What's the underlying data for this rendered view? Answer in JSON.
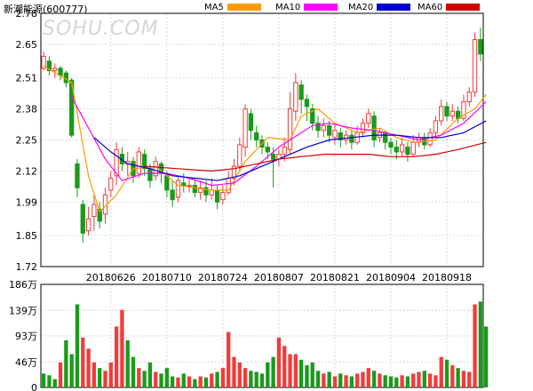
{
  "title": "新潮能源(600777)",
  "watermark": "SOHU.COM",
  "legend": [
    {
      "name": "MA5",
      "color": "#ff9900"
    },
    {
      "name": "MA10",
      "color": "#ff00ff"
    },
    {
      "name": "MA20",
      "color": "#0000cc"
    },
    {
      "name": "MA60",
      "color": "#cc0000"
    }
  ],
  "colors": {
    "up": "#f03c3c",
    "down": "#1a9a1a",
    "grid": "#d8d8d8",
    "frame": "#000000"
  },
  "chart_data": [
    {
      "type": "candlestick",
      "ylim": [
        1.72,
        2.78
      ],
      "yticks": [
        "2.78",
        "2.65",
        "2.51",
        "2.38",
        "2.25",
        "2.12",
        "1.99",
        "1.85",
        "1.72"
      ],
      "xticks": [
        "20180626",
        "20180710",
        "20180724",
        "20180807",
        "20180821",
        "20180904",
        "20180918"
      ],
      "xtick_index": [
        12,
        22,
        32,
        42,
        52,
        62,
        72
      ],
      "candles": [
        [
          2.55,
          2.6,
          2.62,
          2.54
        ],
        [
          2.58,
          2.54,
          2.6,
          2.52
        ],
        [
          2.54,
          2.55,
          2.57,
          2.51
        ],
        [
          2.55,
          2.52,
          2.56,
          2.5
        ],
        [
          2.53,
          2.49,
          2.54,
          2.47
        ],
        [
          2.5,
          2.27,
          2.51,
          2.26
        ],
        [
          2.15,
          2.05,
          2.17,
          2.01
        ],
        [
          1.98,
          1.86,
          2.0,
          1.82
        ],
        [
          1.87,
          1.92,
          1.97,
          1.85
        ],
        [
          1.93,
          1.98,
          2.02,
          1.87
        ],
        [
          1.96,
          1.91,
          1.99,
          1.88
        ],
        [
          1.94,
          2.02,
          2.05,
          1.9
        ],
        [
          2.04,
          2.09,
          2.12,
          2.01
        ],
        [
          2.1,
          2.21,
          2.24,
          2.06
        ],
        [
          2.19,
          2.15,
          2.22,
          2.12
        ],
        [
          2.15,
          2.16,
          2.2,
          2.1
        ],
        [
          2.16,
          2.1,
          2.18,
          2.07
        ],
        [
          2.11,
          2.2,
          2.22,
          2.09
        ],
        [
          2.19,
          2.13,
          2.21,
          2.1
        ],
        [
          2.13,
          2.08,
          2.15,
          2.05
        ],
        [
          2.1,
          2.16,
          2.18,
          2.08
        ],
        [
          2.15,
          2.11,
          2.16,
          2.07
        ],
        [
          2.1,
          2.04,
          2.12,
          2.01
        ],
        [
          2.04,
          2.0,
          2.08,
          1.97
        ],
        [
          2.01,
          2.08,
          2.1,
          1.99
        ],
        [
          2.07,
          2.06,
          2.11,
          2.03
        ],
        [
          2.06,
          2.06,
          2.09,
          2.03
        ],
        [
          2.06,
          2.03,
          2.08,
          2.01
        ],
        [
          2.03,
          2.05,
          2.08,
          2.0
        ],
        [
          2.05,
          2.02,
          2.08,
          1.99
        ],
        [
          2.02,
          2.04,
          2.09,
          2.0
        ],
        [
          2.04,
          1.99,
          2.06,
          1.96
        ],
        [
          2.0,
          2.03,
          2.06,
          1.98
        ],
        [
          2.03,
          2.09,
          2.12,
          2.02
        ],
        [
          2.09,
          2.14,
          2.17,
          2.06
        ],
        [
          2.14,
          2.23,
          2.26,
          2.12
        ],
        [
          2.22,
          2.38,
          2.4,
          2.18
        ],
        [
          2.36,
          2.29,
          2.38,
          2.25
        ],
        [
          2.28,
          2.25,
          2.31,
          2.22
        ],
        [
          2.25,
          2.22,
          2.27,
          2.19
        ],
        [
          2.22,
          2.2,
          2.24,
          2.17
        ],
        [
          2.19,
          2.17,
          2.22,
          2.05
        ],
        [
          2.17,
          2.19,
          2.21,
          2.14
        ],
        [
          2.19,
          2.22,
          2.26,
          2.16
        ],
        [
          2.21,
          2.38,
          2.45,
          2.19
        ],
        [
          2.37,
          2.49,
          2.53,
          2.33
        ],
        [
          2.48,
          2.42,
          2.5,
          2.36
        ],
        [
          2.42,
          2.39,
          2.44,
          2.33
        ],
        [
          2.38,
          2.32,
          2.4,
          2.29
        ],
        [
          2.32,
          2.29,
          2.35,
          2.26
        ],
        [
          2.29,
          2.31,
          2.34,
          2.26
        ],
        [
          2.31,
          2.27,
          2.33,
          2.24
        ],
        [
          2.26,
          2.29,
          2.32,
          2.23
        ],
        [
          2.28,
          2.25,
          2.3,
          2.22
        ],
        [
          2.25,
          2.27,
          2.29,
          2.23
        ],
        [
          2.27,
          2.24,
          2.29,
          2.21
        ],
        [
          2.24,
          2.28,
          2.31,
          2.23
        ],
        [
          2.28,
          2.32,
          2.34,
          2.26
        ],
        [
          2.32,
          2.36,
          2.38,
          2.3
        ],
        [
          2.35,
          2.25,
          2.37,
          2.22
        ],
        [
          2.26,
          2.28,
          2.3,
          2.24
        ],
        [
          2.28,
          2.24,
          2.29,
          2.21
        ],
        [
          2.24,
          2.22,
          2.26,
          2.19
        ],
        [
          2.22,
          2.2,
          2.25,
          2.17
        ],
        [
          2.2,
          2.23,
          2.26,
          2.18
        ],
        [
          2.22,
          2.19,
          2.24,
          2.16
        ],
        [
          2.19,
          2.24,
          2.27,
          2.18
        ],
        [
          2.24,
          2.26,
          2.28,
          2.22
        ],
        [
          2.26,
          2.23,
          2.28,
          2.21
        ],
        [
          2.23,
          2.28,
          2.3,
          2.22
        ],
        [
          2.28,
          2.33,
          2.35,
          2.26
        ],
        [
          2.33,
          2.39,
          2.42,
          2.31
        ],
        [
          2.39,
          2.35,
          2.41,
          2.33
        ],
        [
          2.35,
          2.37,
          2.4,
          2.33
        ],
        [
          2.37,
          2.34,
          2.39,
          2.32
        ],
        [
          2.34,
          2.41,
          2.44,
          2.33
        ],
        [
          2.41,
          2.45,
          2.47,
          2.39
        ],
        [
          2.45,
          2.67,
          2.7,
          2.43
        ],
        [
          2.67,
          2.61,
          2.72,
          2.58
        ]
      ],
      "ma_lines": {
        "MA5": [
          [
            0,
            2.56
          ],
          [
            5,
            2.49
          ],
          [
            8,
            2.1
          ],
          [
            10,
            1.95
          ],
          [
            13,
            2.02
          ],
          [
            16,
            2.13
          ],
          [
            20,
            2.14
          ],
          [
            24,
            2.06
          ],
          [
            30,
            2.04
          ],
          [
            33,
            2.04
          ],
          [
            36,
            2.16
          ],
          [
            40,
            2.26
          ],
          [
            44,
            2.25
          ],
          [
            46,
            2.35
          ],
          [
            49,
            2.38
          ],
          [
            52,
            2.32
          ],
          [
            56,
            2.28
          ],
          [
            60,
            2.3
          ],
          [
            63,
            2.26
          ],
          [
            66,
            2.24
          ],
          [
            70,
            2.25
          ],
          [
            74,
            2.34
          ],
          [
            77,
            2.38
          ],
          [
            79,
            2.44
          ]
        ],
        "MA10": [
          [
            5,
            2.43
          ],
          [
            8,
            2.3
          ],
          [
            11,
            2.17
          ],
          [
            14,
            2.08
          ],
          [
            18,
            2.11
          ],
          [
            22,
            2.11
          ],
          [
            26,
            2.09
          ],
          [
            30,
            2.06
          ],
          [
            34,
            2.07
          ],
          [
            38,
            2.14
          ],
          [
            42,
            2.22
          ],
          [
            46,
            2.28
          ],
          [
            48,
            2.31
          ],
          [
            51,
            2.32
          ],
          [
            55,
            2.3
          ],
          [
            59,
            2.29
          ],
          [
            63,
            2.27
          ],
          [
            67,
            2.25
          ],
          [
            71,
            2.27
          ],
          [
            75,
            2.32
          ],
          [
            79,
            2.41
          ]
        ],
        "MA20": [
          [
            9,
            2.26
          ],
          [
            12,
            2.2
          ],
          [
            15,
            2.15
          ],
          [
            19,
            2.13
          ],
          [
            23,
            2.1
          ],
          [
            27,
            2.09
          ],
          [
            31,
            2.08
          ],
          [
            35,
            2.1
          ],
          [
            39,
            2.14
          ],
          [
            43,
            2.18
          ],
          [
            47,
            2.22
          ],
          [
            51,
            2.25
          ],
          [
            55,
            2.26
          ],
          [
            59,
            2.27
          ],
          [
            63,
            2.27
          ],
          [
            67,
            2.26
          ],
          [
            71,
            2.26
          ],
          [
            75,
            2.28
          ],
          [
            79,
            2.33
          ]
        ],
        "MA60": [
          [
            18,
            2.14
          ],
          [
            24,
            2.13
          ],
          [
            30,
            2.12
          ],
          [
            34,
            2.13
          ],
          [
            38,
            2.15
          ],
          [
            42,
            2.17
          ],
          [
            46,
            2.18
          ],
          [
            50,
            2.19
          ],
          [
            54,
            2.19
          ],
          [
            58,
            2.19
          ],
          [
            62,
            2.18
          ],
          [
            66,
            2.18
          ],
          [
            70,
            2.19
          ],
          [
            74,
            2.21
          ],
          [
            79,
            2.24
          ]
        ]
      }
    },
    {
      "type": "bar",
      "ylabel": "万",
      "ylim": [
        0,
        186
      ],
      "yticks": [
        "186万",
        "139万",
        "93万",
        "46万",
        "0"
      ],
      "values": [
        25,
        22,
        15,
        45,
        85,
        60,
        150,
        90,
        70,
        45,
        35,
        30,
        45,
        110,
        140,
        85,
        55,
        35,
        30,
        45,
        28,
        25,
        35,
        20,
        18,
        25,
        20,
        15,
        20,
        18,
        25,
        28,
        35,
        100,
        55,
        45,
        35,
        30,
        28,
        25,
        45,
        55,
        90,
        75,
        60,
        60,
        50,
        40,
        45,
        30,
        25,
        28,
        20,
        25,
        22,
        20,
        25,
        28,
        35,
        30,
        25,
        22,
        20,
        18,
        22,
        20,
        25,
        28,
        30,
        25,
        22,
        55,
        50,
        40,
        35,
        30,
        28,
        150,
        155,
        110
      ],
      "up": [
        0,
        0,
        0,
        1,
        0,
        0,
        0,
        1,
        1,
        1,
        0,
        1,
        1,
        1,
        1,
        0,
        0,
        1,
        0,
        0,
        1,
        0,
        0,
        0,
        1,
        0,
        1,
        0,
        1,
        0,
        1,
        0,
        1,
        1,
        1,
        1,
        1,
        0,
        0,
        0,
        0,
        0,
        1,
        1,
        1,
        1,
        0,
        0,
        0,
        0,
        1,
        0,
        1,
        0,
        1,
        0,
        1,
        1,
        1,
        0,
        1,
        0,
        0,
        0,
        1,
        0,
        1,
        1,
        0,
        1,
        1,
        1,
        0,
        1,
        0,
        1,
        1,
        1,
        0,
        0
      ]
    }
  ]
}
